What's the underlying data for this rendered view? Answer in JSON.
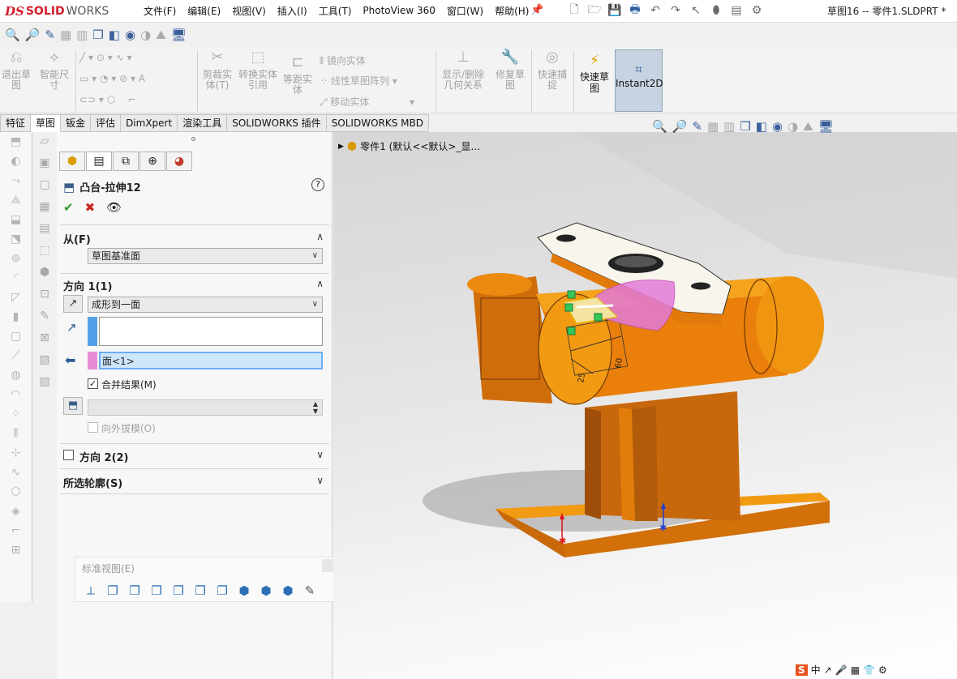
{
  "app": {
    "logo_ds": "DS",
    "logo_solid": "SOLID",
    "logo_works": "WORKS",
    "document_title": "草图16 -- 零件1.SLDPRT *"
  },
  "menus": [
    "文件(F)",
    "编辑(E)",
    "视图(V)",
    "插入(I)",
    "工具(T)",
    "PhotoView 360",
    "窗口(W)",
    "帮助(H)"
  ],
  "ribbon": {
    "exit_sketch": "退出草图",
    "smart_dimension": "智能尺寸",
    "trim_entities": "剪裁实体(T)",
    "convert_entities": "转换实体引用",
    "offset_entities": "等距实体",
    "mirror_entities": "镜向实体",
    "linear_pattern": "线性草图阵列",
    "move_entities": "移动实体",
    "show_relations": "显示/删除几何关系",
    "repair_sketch": "修复草图",
    "quick_snaps": "快速捕捉",
    "rapid_sketch": "快速草图",
    "instant2d": "Instant2D"
  },
  "tabs": [
    "特征",
    "草图",
    "钣金",
    "评估",
    "DimXpert",
    "渲染工具",
    "SOLIDWORKS 插件",
    "SOLIDWORKS MBD"
  ],
  "active_tab": 1,
  "property_manager": {
    "title": "凸台-拉伸12",
    "help": "?",
    "from_section": "从(F)",
    "from_value": "草图基准面",
    "direction1_section": "方向 1(1)",
    "end_condition": "成形到一面",
    "face_selection": "面<1>",
    "merge_result_label": "合并结果(M)",
    "merge_result_checked": true,
    "draft_outward_label": "向外拔模(O)",
    "draft_outward_checked": false,
    "direction2_section": "方向 2(2)",
    "selected_contours_section": "所选轮廓(S)"
  },
  "standard_views": {
    "title": "标准视图(E)"
  },
  "viewport": {
    "tree_label": "零件1  (默认<<默认>_显..."
  },
  "model": {
    "dim_60": "60",
    "dim_25": "25"
  },
  "colors": {
    "body_orange": "#e8820a",
    "body_dark": "#b9560a",
    "face_white": "#f7f3ea",
    "selection_pink": "#e27ad8",
    "instant2d_bg": "#c7d3e0"
  }
}
